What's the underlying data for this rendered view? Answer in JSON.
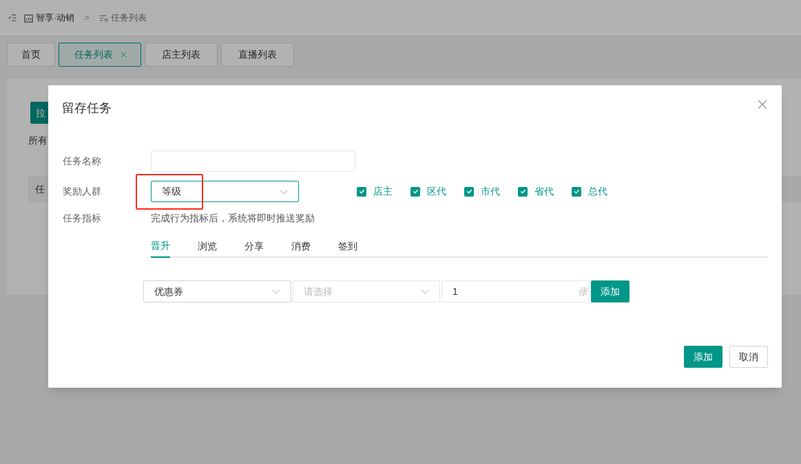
{
  "breadcrumb": [
    {
      "label": "智享·动销"
    },
    {
      "label": "任务列表"
    }
  ],
  "breadcrumb_separator": ">",
  "page_tabs": [
    {
      "label": "首页",
      "selected": false,
      "closable": false
    },
    {
      "label": "任务列表",
      "selected": true,
      "closable": true
    },
    {
      "label": "店主列表",
      "selected": false,
      "closable": false
    },
    {
      "label": "直播列表",
      "selected": false,
      "closable": false
    }
  ],
  "background": {
    "button": "拉",
    "filter_tab": "所有",
    "table_header": "任"
  },
  "dialog": {
    "title": "留存任务",
    "fields": [
      {
        "kind": "input",
        "label": "任务名称"
      },
      {
        "kind": "select",
        "label": "奖励人群",
        "value": "等级",
        "highlighted": true,
        "options": [
          {
            "label": "店主",
            "checked": true
          },
          {
            "label": "区代",
            "checked": true
          },
          {
            "label": "市代",
            "checked": true
          },
          {
            "label": "省代",
            "checked": true
          },
          {
            "label": "总代",
            "checked": true
          }
        ]
      },
      {
        "kind": "text",
        "label": "任务指标",
        "value": "完成行为指标后，系统将即时推送奖励"
      }
    ],
    "metric_tabs": [
      {
        "label": "晋升",
        "selected": true
      },
      {
        "label": "浏览",
        "selected": false
      },
      {
        "label": "分享",
        "selected": false
      },
      {
        "label": "消费",
        "selected": false
      },
      {
        "label": "签到",
        "selected": false
      }
    ],
    "reward": {
      "type": "优惠券",
      "coupon_placeholder": "请选择",
      "quantity": "1",
      "unit": "张",
      "add_button": "添加"
    },
    "buttons": [
      {
        "label": "添加",
        "kind": "primary"
      },
      {
        "label": "取消",
        "kind": "default"
      }
    ]
  }
}
